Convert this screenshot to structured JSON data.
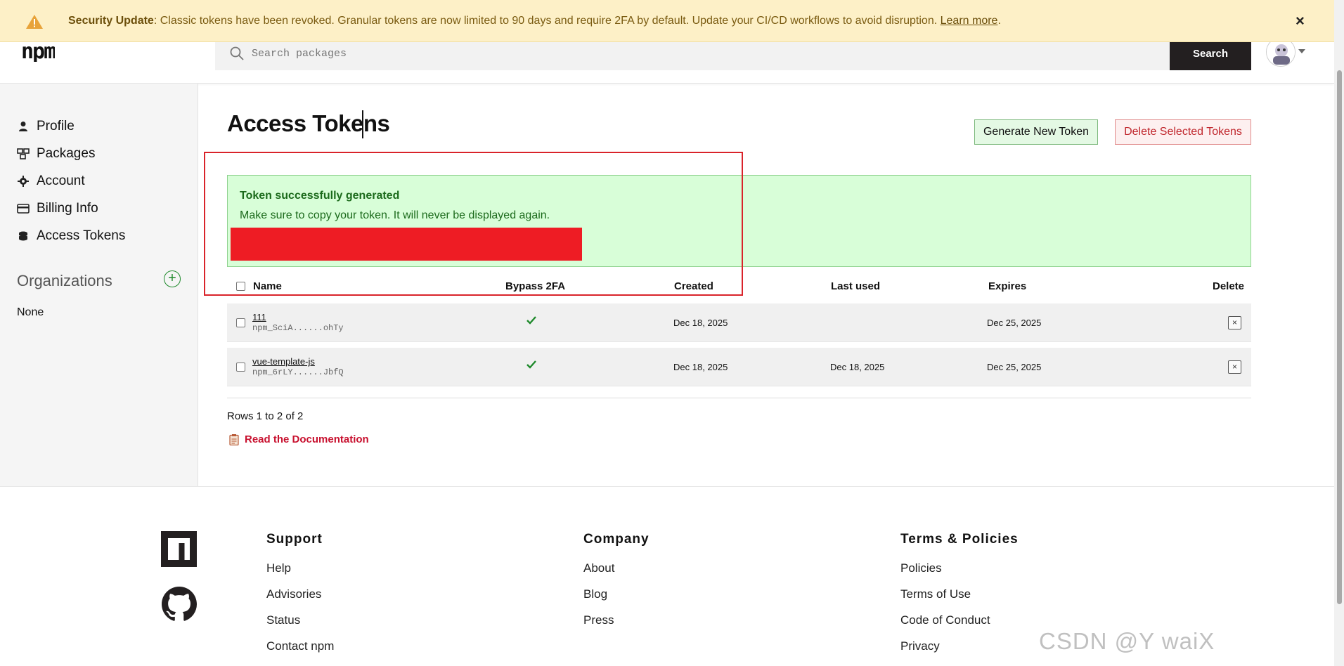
{
  "banner": {
    "label": "Security Update",
    "message": ": Classic tokens have been revoked. Granular tokens are now limited to 90 days and require 2FA by default. Update your CI/CD workflows to avoid disruption. ",
    "link": "Learn more",
    "end": ".",
    "close": "×"
  },
  "header": {
    "logo": "npm",
    "search_placeholder": "Search packages",
    "search_button": "Search"
  },
  "sidebar": {
    "items": [
      {
        "label": "Profile",
        "icon": "user-icon"
      },
      {
        "label": "Packages",
        "icon": "packages-icon"
      },
      {
        "label": "Account",
        "icon": "gear-icon"
      },
      {
        "label": "Billing Info",
        "icon": "credit-card-icon"
      },
      {
        "label": "Access Tokens",
        "icon": "tokens-icon"
      }
    ],
    "organizations_title": "Organizations",
    "organizations_empty": "None"
  },
  "main": {
    "title": "Access Tokens",
    "generate_button": "Generate New Token",
    "delete_button": "Delete Selected Tokens",
    "alert": {
      "title": "Token successfully generated",
      "message": "Make sure to copy your token. It will never be displayed again."
    },
    "table": {
      "headers": {
        "name": "Name",
        "bypass": "Bypass 2FA",
        "created": "Created",
        "last_used": "Last used",
        "expires": "Expires",
        "delete": "Delete"
      },
      "rows": [
        {
          "name": "111",
          "masked": "npm_SciA......ohTy",
          "bypass": "✔",
          "created": "Dec 18, 2025",
          "last_used": "",
          "expires": "Dec 25, 2025"
        },
        {
          "name": "vue-template-js",
          "masked": "npm_6rLY......JbfQ",
          "bypass": "✔",
          "created": "Dec 18, 2025",
          "last_used": "Dec 18, 2025",
          "expires": "Dec 25, 2025"
        }
      ]
    },
    "rows_info": "Rows 1 to 2 of 2",
    "doc_link": "Read the Documentation"
  },
  "footer": {
    "columns": [
      {
        "title": "Support",
        "links": [
          "Help",
          "Advisories",
          "Status",
          "Contact npm"
        ]
      },
      {
        "title": "Company",
        "links": [
          "About",
          "Blog",
          "Press"
        ]
      },
      {
        "title": "Terms & Policies",
        "links": [
          "Policies",
          "Terms of Use",
          "Code of Conduct",
          "Privacy"
        ]
      }
    ]
  },
  "watermark": "CSDN @Y waiX",
  "colors": {
    "banner_bg": "#fdf0c7",
    "success_bg": "#d8fed8",
    "success_text": "#1b6a1b",
    "danger": "#c0272d",
    "npm_dark": "#231f20",
    "redaction": "#ee1c24"
  }
}
